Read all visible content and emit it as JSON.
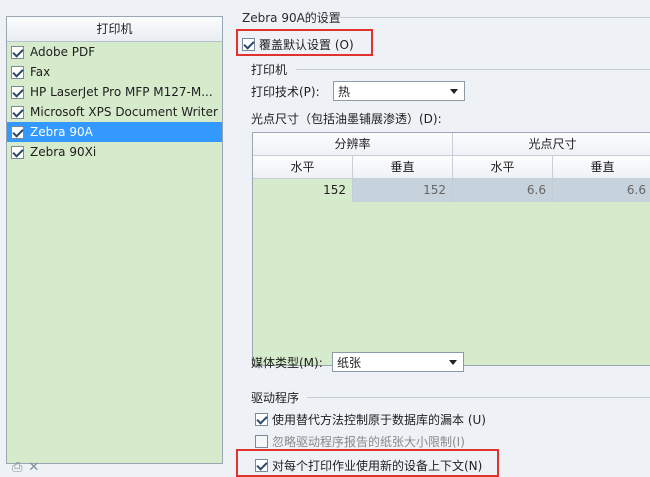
{
  "printer_list": {
    "header": "打印机",
    "items": [
      {
        "label": "Adobe PDF",
        "checked": true,
        "selected": false
      },
      {
        "label": "Fax",
        "checked": true,
        "selected": false
      },
      {
        "label": "HP LaserJet Pro MFP M127-M...",
        "checked": true,
        "selected": false
      },
      {
        "label": "Microsoft XPS Document Writer",
        "checked": true,
        "selected": false
      },
      {
        "label": "Zebra 90A",
        "checked": true,
        "selected": true
      },
      {
        "label": "Zebra 90Xi",
        "checked": true,
        "selected": false
      }
    ]
  },
  "settings": {
    "title": "Zebra 90A的设置",
    "override_default": {
      "label": "覆盖默认设置 (O)",
      "checked": true
    },
    "printer_group": {
      "label": "打印机",
      "print_tech_label": "打印技术(P):",
      "print_tech_value": "热"
    },
    "dpi_label": "光点尺寸（包括油墨铺展渗透）(D):",
    "dpi_table": {
      "group_headers": [
        "分辨率",
        "光点尺寸"
      ],
      "sub_headers": [
        "水平",
        "垂直",
        "水平",
        "垂直"
      ],
      "row": [
        "152",
        "152",
        "6.6",
        "6.6"
      ]
    },
    "media_type": {
      "label": "媒体类型(M):",
      "value": "纸张"
    },
    "driver_group": {
      "label": "驱动程序",
      "options": [
        {
          "label": "使用替代方法控制原于数据库的漏本 (U)",
          "checked": true,
          "disabled": false
        },
        {
          "label": "忽略驱动程序报告的纸张大小限制(I)",
          "checked": false,
          "disabled": true
        },
        {
          "label": "对每个打印作业使用新的设备上下文(N)",
          "checked": true,
          "disabled": false
        }
      ]
    }
  },
  "colors": {
    "highlight": "#e0332e",
    "selection": "#3399ff",
    "list_bg": "#d6ebcc"
  }
}
